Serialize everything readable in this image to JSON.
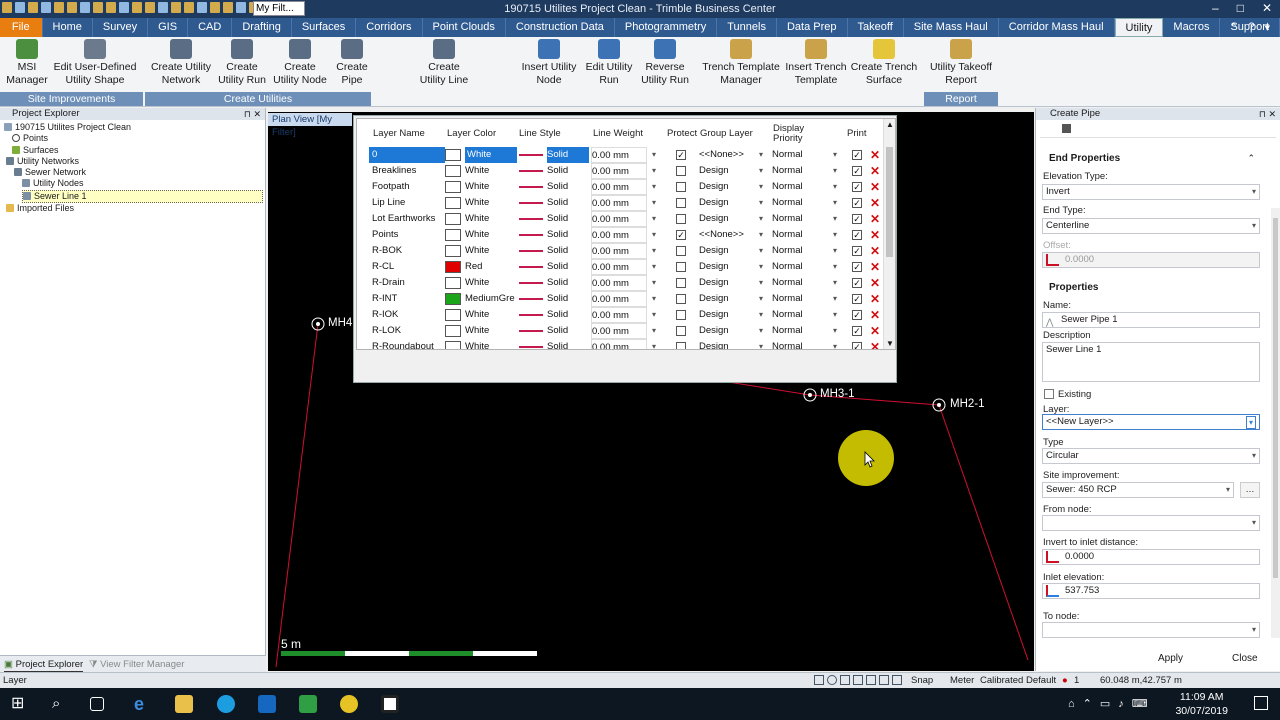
{
  "title_bar": {
    "filter": "My Filt...",
    "title": "190715 Utilites Project Clean - Trimble Business Center",
    "minimize": "–",
    "maximize": "□",
    "close": "✕"
  },
  "tabs": [
    "File",
    "Home",
    "Survey",
    "GIS",
    "CAD",
    "Drafting",
    "Surfaces",
    "Corridors",
    "Point Clouds",
    "Construction Data",
    "Photogrammetry",
    "Tunnels",
    "Data Prep",
    "Takeoff",
    "Site Mass Haul",
    "Corridor Mass Haul",
    "Utility",
    "Macros",
    "Support"
  ],
  "ribbon": {
    "buttons": [
      "MSI Manager",
      "Edit User-Defined Utility Shape",
      "Create Utility Network",
      "Create Utility Run",
      "Create Utility Node",
      "Create Pipe",
      "Create Utility Line",
      "Insert Utility Node",
      "Edit Utility Run",
      "Reverse Utility Run",
      "Trench Template Manager",
      "Insert Trench Template",
      "Create Trench Surface",
      "Utility Takeoff Report"
    ],
    "groups": [
      "Site Improvements",
      "Create Utilities",
      "Report"
    ]
  },
  "explorer": {
    "title": "Project Explorer",
    "items": [
      "190715 Utilites Project Clean",
      "Points",
      "Surfaces",
      "Utility Networks",
      "Sewer Network",
      "Utility Nodes",
      "Sewer Line 1",
      "Imported Files"
    ],
    "tabs": [
      "Project Explorer",
      "View Filter Manager"
    ]
  },
  "plan": {
    "label": "Plan View [My Filter]",
    "nodes": [
      "MH4",
      "MH3-1",
      "MH2-1"
    ],
    "scale": "5 m"
  },
  "layers": {
    "headers": [
      "Layer Name",
      "Layer Color",
      "Line Style",
      "Line Weight",
      "Protect",
      "Group Layer",
      "Display Priority",
      "Print"
    ],
    "rows": [
      {
        "name": "0",
        "color": "White",
        "swatch": "#ffffff",
        "style": "Solid",
        "weight": "0.00 mm",
        "protect": true,
        "group": "<<None>>",
        "priority": "Normal",
        "print": true
      },
      {
        "name": "Breaklines",
        "color": "White",
        "swatch": "#ffffff",
        "style": "Solid",
        "weight": "0.00 mm",
        "protect": false,
        "group": "Design",
        "priority": "Normal",
        "print": true
      },
      {
        "name": "Footpath",
        "color": "White",
        "swatch": "#ffffff",
        "style": "Solid",
        "weight": "0.00 mm",
        "protect": false,
        "group": "Design",
        "priority": "Normal",
        "print": true
      },
      {
        "name": "Lip Line",
        "color": "White",
        "swatch": "#ffffff",
        "style": "Solid",
        "weight": "0.00 mm",
        "protect": false,
        "group": "Design",
        "priority": "Normal",
        "print": true
      },
      {
        "name": "Lot Earthworks",
        "color": "White",
        "swatch": "#ffffff",
        "style": "Solid",
        "weight": "0.00 mm",
        "protect": false,
        "group": "Design",
        "priority": "Normal",
        "print": true
      },
      {
        "name": "Points",
        "color": "White",
        "swatch": "#ffffff",
        "style": "Solid",
        "weight": "0.00 mm",
        "protect": true,
        "group": "<<None>>",
        "priority": "Normal",
        "print": true
      },
      {
        "name": "R-BOK",
        "color": "White",
        "swatch": "#ffffff",
        "style": "Solid",
        "weight": "0.00 mm",
        "protect": false,
        "group": "Design",
        "priority": "Normal",
        "print": true
      },
      {
        "name": "R-CL",
        "color": "Red",
        "swatch": "#e00000",
        "style": "Solid",
        "weight": "0.00 mm",
        "protect": false,
        "group": "Design",
        "priority": "Normal",
        "print": true
      },
      {
        "name": "R-Drain",
        "color": "White",
        "swatch": "#ffffff",
        "style": "Solid",
        "weight": "0.00 mm",
        "protect": false,
        "group": "Design",
        "priority": "Normal",
        "print": true
      },
      {
        "name": "R-INT",
        "color": "MediumGre",
        "swatch": "#1aa51a",
        "style": "Solid",
        "weight": "0.00 mm",
        "protect": false,
        "group": "Design",
        "priority": "Normal",
        "print": true
      },
      {
        "name": "R-IOK",
        "color": "White",
        "swatch": "#ffffff",
        "style": "Solid",
        "weight": "0.00 mm",
        "protect": false,
        "group": "Design",
        "priority": "Normal",
        "print": true
      },
      {
        "name": "R-LOK",
        "color": "White",
        "swatch": "#ffffff",
        "style": "Solid",
        "weight": "0.00 mm",
        "protect": false,
        "group": "Design",
        "priority": "Normal",
        "print": true
      },
      {
        "name": "R-Roundabout",
        "color": "White",
        "swatch": "#ffffff",
        "style": "Solid",
        "weight": "0.00 mm",
        "protect": false,
        "group": "Design",
        "priority": "Normal",
        "print": true
      }
    ]
  },
  "create_pipe": {
    "title": "Create Pipe",
    "end_section": "End Properties",
    "elevation_type_label": "Elevation Type:",
    "elevation_type": "Invert",
    "end_type_label": "End Type:",
    "end_type": "Centerline",
    "offset_label": "Offset:",
    "offset": "0.0000",
    "properties_section": "Properties",
    "name_label": "Name:",
    "name": "Sewer Pipe 1",
    "description_label": "Description",
    "description": "Sewer Line 1",
    "existing_label": "Existing",
    "layer_label": "Layer:",
    "layer": "<<New Layer>>",
    "type_label": "Type",
    "type": "Circular",
    "site_improvement_label": "Site improvement:",
    "site_improvement": "Sewer: 450 RCP",
    "from_node_label": "From node:",
    "invert_to_inlet_label": "Invert to inlet distance:",
    "invert_to_inlet": "0.0000",
    "inlet_elevation_label": "Inlet elevation:",
    "inlet_elevation": "537.753",
    "to_node_label": "To node:",
    "apply": "Apply",
    "close": "Close"
  },
  "status_bar": {
    "left": "Layer",
    "snap": "Snap",
    "units": "Meter",
    "calibrated": "Calibrated",
    "default": "Default",
    "count": "1",
    "coords": "60.048 m,42.757 m"
  },
  "taskbar": {
    "time": "11:09 AM",
    "date": "30/07/2019"
  }
}
